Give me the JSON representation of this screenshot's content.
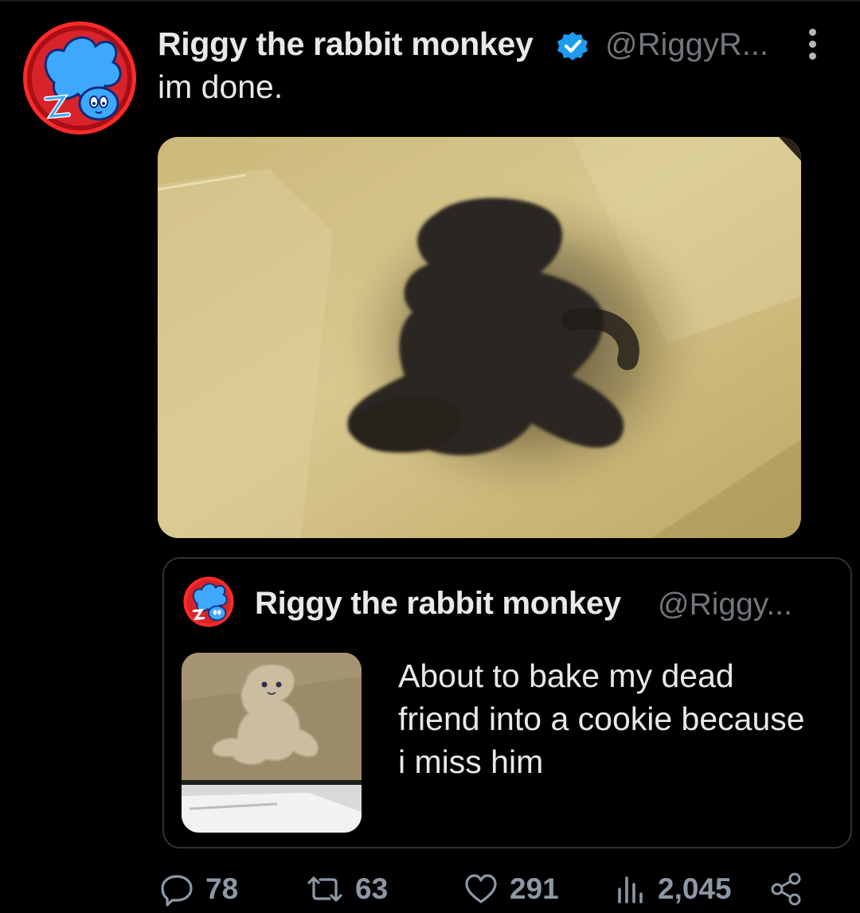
{
  "tweet": {
    "author_name": "Riggy the rabbit monkey",
    "author_handle": "@RiggyR...",
    "verified": true,
    "text": "im done."
  },
  "quoted_tweet": {
    "author_name": "Riggy the rabbit monkey",
    "author_handle": "@Riggy...",
    "text": "About to bake my dead friend into a cookie because i miss him"
  },
  "actions": {
    "replies": "78",
    "retweets": "63",
    "likes": "291",
    "views": "2,045"
  },
  "colors": {
    "background": "#000000",
    "text": "#e7e9ea",
    "muted": "#71767b",
    "verified": "#1d9bf0",
    "border": "#2f3336"
  },
  "icons": [
    "more-icon",
    "verified-icon",
    "reply-icon",
    "retweet-icon",
    "like-icon",
    "views-icon",
    "share-icon"
  ]
}
